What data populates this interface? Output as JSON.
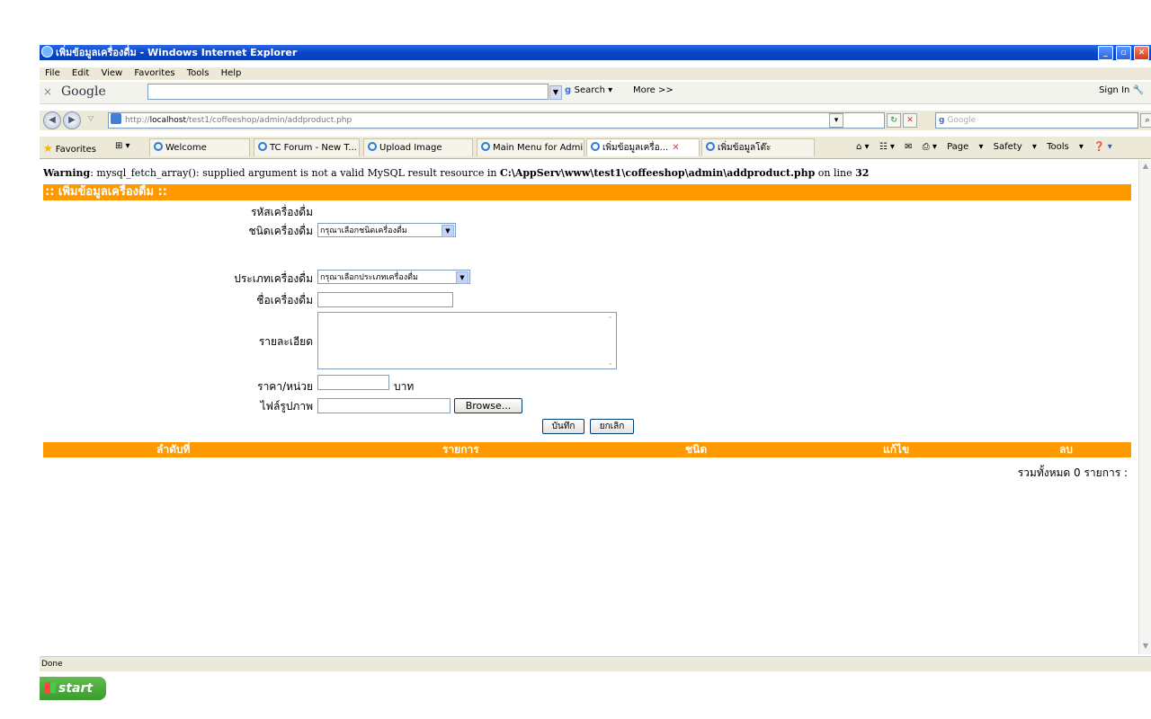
{
  "window": {
    "title": "เพิ่มข้อมูลเครื่องดื่ม - Windows Internet Explorer"
  },
  "menu": [
    "File",
    "Edit",
    "View",
    "Favorites",
    "Tools",
    "Help"
  ],
  "google_toolbar": {
    "logo": "Google",
    "search_label": "Search",
    "more_label": "More >>",
    "sign_in": "Sign In"
  },
  "address": {
    "prefix": "http://",
    "host": "localhost",
    "path": "/test1/coffeeshop/admin/addproduct.php",
    "search_placeholder": "Google"
  },
  "favorites": {
    "label": "Favorites"
  },
  "tabs": [
    {
      "label": "Welcome",
      "active": false
    },
    {
      "label": "TC Forum - New T...",
      "active": false
    },
    {
      "label": "Upload Image",
      "active": false
    },
    {
      "label": "Main Menu for Admin",
      "active": false
    },
    {
      "label": "เพิ่มข้อมูลเครื่อ...",
      "active": true
    },
    {
      "label": "เพิ่มข้อมูลโต๊ะ",
      "active": false
    }
  ],
  "command_bar": {
    "page": "Page",
    "safety": "Safety",
    "tools": "Tools"
  },
  "warning": {
    "prefix": "Warning",
    "message": ": mysql_fetch_array(): supplied argument is not a valid MySQL result resource in ",
    "file": "C:\\AppServ\\www\\test1\\coffeeshop\\admin\\addproduct.php",
    "on_line": " on line ",
    "line": "32"
  },
  "form": {
    "header": ":: เพิ่มข้อมูลเครื่องดื่ม ::",
    "labels": {
      "code": "รหัสเครื่องดื่ม",
      "kind": "ชนิดเครื่องดื่ม",
      "category": "ประเภทเครื่องดื่ม",
      "name": "ชื่อเครื่องดื่ม",
      "detail": "รายละเอียด",
      "price": "ราคา/หน่วย",
      "image": "ไฟล์รูปภาพ"
    },
    "kind_select": "กรุณาเลือกชนิดเครื่องดื่ม",
    "category_select": "กรุณาเลือกประเภทเครื่องดื่ม",
    "price_unit": "บาท",
    "browse": "Browse...",
    "save": "บันทึก",
    "cancel": "ยกเลิก"
  },
  "list": {
    "columns": [
      "ลำดับที่",
      "รายการ",
      "ชนิด",
      "แก้ไข",
      "ลบ"
    ],
    "total": "รวมทั้งหมด 0 รายการ :"
  },
  "status": {
    "text": "Done"
  },
  "taskbar": {
    "start": "start"
  }
}
